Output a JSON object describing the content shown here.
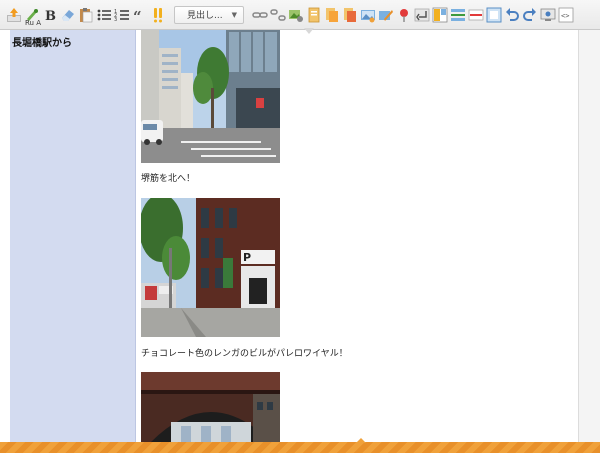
{
  "toolbar": {
    "heading_select": "見出し...",
    "small_label": "Ru  A"
  },
  "sidebar": {
    "text": "長堀橋駅から"
  },
  "content": {
    "captions": [
      "堺筋を北へ！",
      "チョコレート色のレンガのビルがパレロワイヤル！"
    ]
  },
  "colors": {
    "sidebar_bg": "#d3dbf0",
    "bottom_bar": "#f0a13a"
  }
}
